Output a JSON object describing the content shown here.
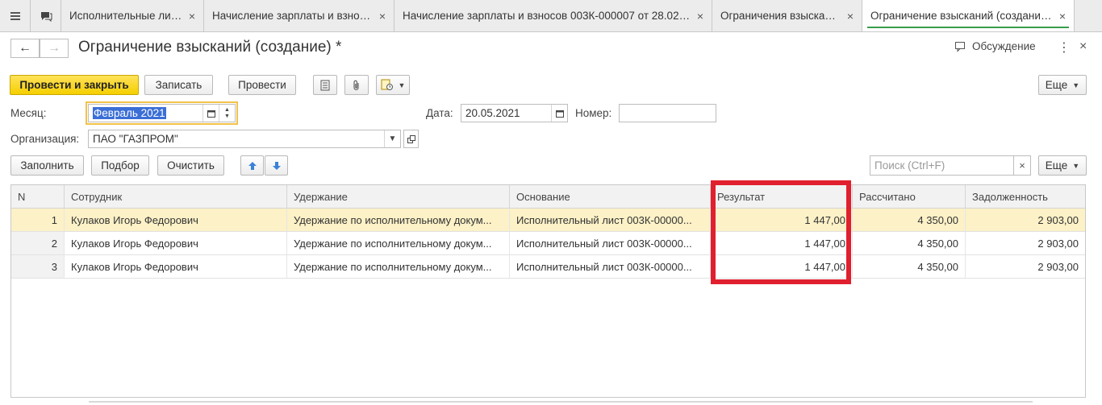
{
  "tabs": [
    {
      "label": "Исполнительные листы"
    },
    {
      "label": "Начисление зарплаты и взносов"
    },
    {
      "label": "Начисление зарплаты и взносов 003К-000007 от 28.02...."
    },
    {
      "label": "Ограничения взысканий"
    },
    {
      "label": "Ограничение взысканий (создание) *"
    }
  ],
  "header": {
    "title": "Ограничение взысканий (создание) *",
    "discuss_label": "Обсуждение"
  },
  "toolbar": {
    "post_close": "Провести и закрыть",
    "save": "Записать",
    "post": "Провести",
    "more": "Еще"
  },
  "form": {
    "month_label": "Месяц:",
    "month_value": "Февраль 2021",
    "date_label": "Дата:",
    "date_value": "20.05.2021",
    "number_label": "Номер:",
    "number_value": "",
    "org_label": "Организация:",
    "org_value": "ПАО \"ГАЗПРОМ\""
  },
  "table_toolbar": {
    "fill": "Заполнить",
    "pick": "Подбор",
    "clear": "Очистить",
    "search_placeholder": "Поиск (Ctrl+F)",
    "more": "Еще"
  },
  "table": {
    "columns": [
      "N",
      "Сотрудник",
      "Удержание",
      "Основание",
      "Результат",
      "Рассчитано",
      "Задолженность"
    ],
    "rows": [
      [
        "1",
        "Кулаков Игорь Федорович",
        "Удержание по исполнительному докум...",
        "Исполнительный лист 003К-00000...",
        "1 447,00",
        "4 350,00",
        "2 903,00"
      ],
      [
        "2",
        "Кулаков Игорь Федорович",
        "Удержание по исполнительному докум...",
        "Исполнительный лист 003К-00000...",
        "1 447,00",
        "4 350,00",
        "2 903,00"
      ],
      [
        "3",
        "Кулаков Игорь Федорович",
        "Удержание по исполнительному докум...",
        "Исполнительный лист 003К-00000...",
        "1 447,00",
        "4 350,00",
        "2 903,00"
      ]
    ]
  },
  "colors": {
    "accent_yellow": "#f5cf00",
    "highlight_red": "#e0202e",
    "selected_row": "#fcf1c7"
  }
}
